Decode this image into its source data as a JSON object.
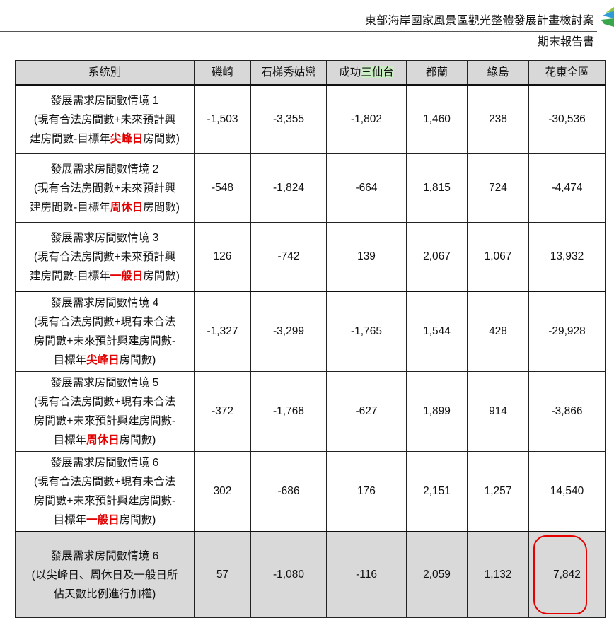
{
  "header": {
    "title": "東部海岸國家風景區觀光整體發展計畫檢討案",
    "subtitle": "期末報告書"
  },
  "table": {
    "columns": {
      "category": "系統別",
      "c1": "磯崎",
      "c2": "石梯秀姑巒",
      "c3_prefix": "成功",
      "c3_highlight": "三仙台",
      "c4": "都蘭",
      "c5": "綠島",
      "c6": "花東全區"
    },
    "rows": [
      {
        "line1": "發展需求房間數情境 1",
        "line2": "(現有合法房間數+未來預計興",
        "line3_pre": "建房間數-目標年",
        "line3_hl": "尖峰日",
        "line3_post": "房間數)",
        "values": [
          "-1,503",
          "-3,355",
          "-1,802",
          "1,460",
          "238",
          "-30,536"
        ]
      },
      {
        "line1": "發展需求房間數情境 2",
        "line2": "(現有合法房間數+未來預計興",
        "line3_pre": "建房間數-目標年",
        "line3_hl": "周休日",
        "line3_post": "房間數)",
        "values": [
          "-548",
          "-1,824",
          "-664",
          "1,815",
          "724",
          "-4,474"
        ]
      },
      {
        "line1": "發展需求房間數情境 3",
        "line2": "(現有合法房間數+未來預計興",
        "line3_pre": "建房間數-目標年",
        "line3_hl": "一般日",
        "line3_post": "房間數)",
        "values": [
          "126",
          "-742",
          "139",
          "2,067",
          "1,067",
          "13,932"
        ]
      },
      {
        "line1": "發展需求房間數情境 4",
        "line2": "(現有合法房間數+現有未合法",
        "line3": "房間數+未來預計興建房間數-",
        "line4_pre": "目標年",
        "line4_hl": "尖峰日",
        "line4_post": "房間數)",
        "values": [
          "-1,327",
          "-3,299",
          "-1,765",
          "1,544",
          "428",
          "-29,928"
        ]
      },
      {
        "line1": "發展需求房間數情境 5",
        "line2": "(現有合法房間數+現有未合法",
        "line3": "房間數+未來預計興建房間數-",
        "line4_pre": "目標年",
        "line4_hl": "周休日",
        "line4_post": "房間數)",
        "values": [
          "-372",
          "-1,768",
          "-627",
          "1,899",
          "914",
          "-3,866"
        ]
      },
      {
        "line1": "發展需求房間數情境 6",
        "line2": "(現有合法房間數+現有未合法",
        "line3": "房間數+未來預計興建房間數-",
        "line4_pre": "目標年",
        "line4_hl": "一般日",
        "line4_post": "房間數)",
        "values": [
          "302",
          "-686",
          "176",
          "2,151",
          "1,257",
          "14,540"
        ]
      },
      {
        "line1": "發展需求房間數情境 6",
        "line2": "(以尖峰日、周休日及一般日所",
        "line3": "佔天數比例進行加權)",
        "values": [
          "57",
          "-1,080",
          "-116",
          "2,059",
          "1,132",
          "7,842"
        ]
      }
    ]
  },
  "colors": {
    "highlight_red": "#e30000",
    "highlight_green": "#c9ecc3",
    "header_fill": "#d8d8d8",
    "annotation_circle": "#e60000"
  },
  "icons": {
    "logo": "leaf-logo-icon"
  }
}
